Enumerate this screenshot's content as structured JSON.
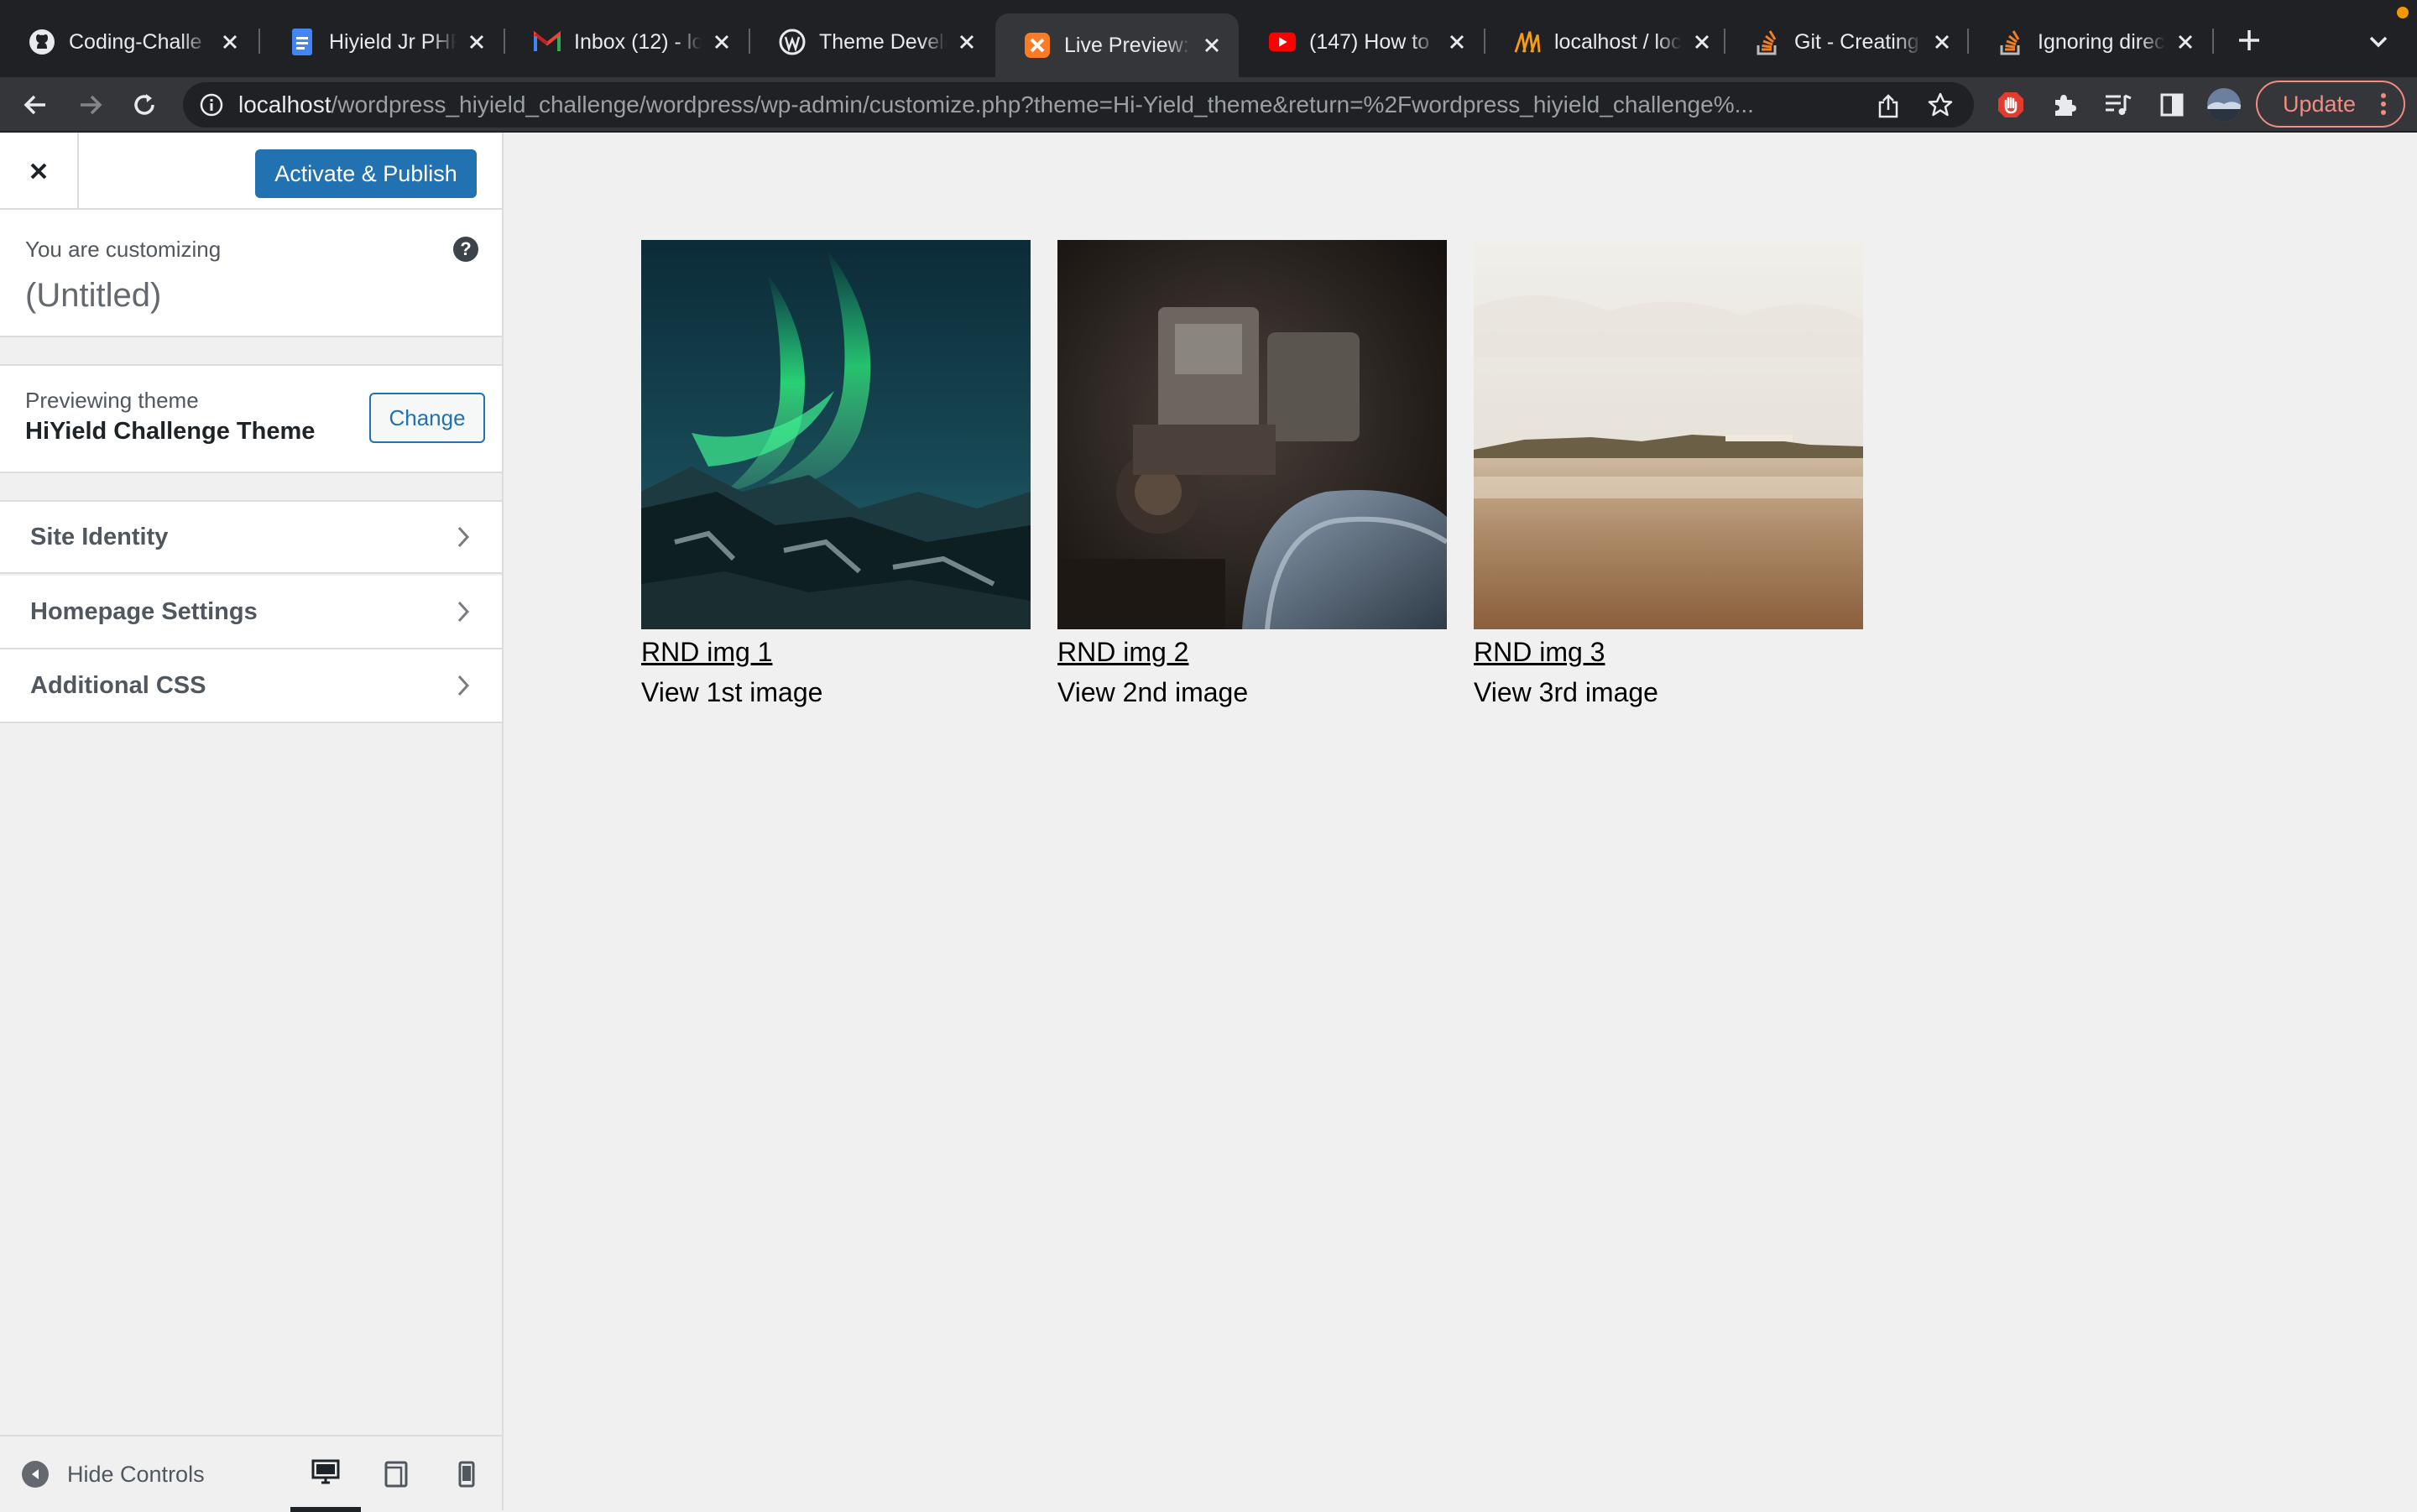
{
  "browser": {
    "tabs": [
      {
        "title": "Coding-Challe",
        "icon": "github-icon"
      },
      {
        "title": "Hiyield Jr PHP",
        "icon": "google-docs-icon"
      },
      {
        "title": "Inbox (12) - lo",
        "icon": "gmail-icon"
      },
      {
        "title": "Theme Develo",
        "icon": "wordpress-icon"
      },
      {
        "title": "Live Preview: ",
        "icon": "xampp-icon",
        "active": true
      },
      {
        "title": "(147) How to C",
        "icon": "youtube-icon"
      },
      {
        "title": "localhost / loc",
        "icon": "phpmyadmin-icon"
      },
      {
        "title": "Git - Creating",
        "icon": "stackoverflow-icon"
      },
      {
        "title": "Ignoring direct",
        "icon": "stackoverflow-icon"
      }
    ],
    "url_host": "localhost",
    "url_path": "/wordpress_hiyield_challenge/wordpress/wp-admin/customize.php?theme=Hi-Yield_theme&return=%2Fwordpress_hiyield_challenge%...",
    "update_label": "Update"
  },
  "customizer": {
    "publish_label": "Activate & Publish",
    "customizing_label": "You are customizing",
    "site_name": "(Untitled)",
    "previewing_label": "Previewing theme",
    "theme_name": "HiYield Challenge Theme",
    "change_label": "Change",
    "sections": [
      "Site Identity",
      "Homepage Settings",
      "Additional CSS"
    ],
    "hide_controls_label": "Hide Controls"
  },
  "preview": {
    "cards": [
      {
        "caption": "RND img 1",
        "subtitle": "View 1st image"
      },
      {
        "caption": "RND img 2",
        "subtitle": "View 2nd image"
      },
      {
        "caption": "RND img 3",
        "subtitle": "View 3rd image"
      }
    ]
  },
  "colors": {
    "accent": "#2271b1",
    "chrome_dark": "#202124",
    "chrome_toolbar": "#35363a",
    "update_red": "#f28b82"
  }
}
